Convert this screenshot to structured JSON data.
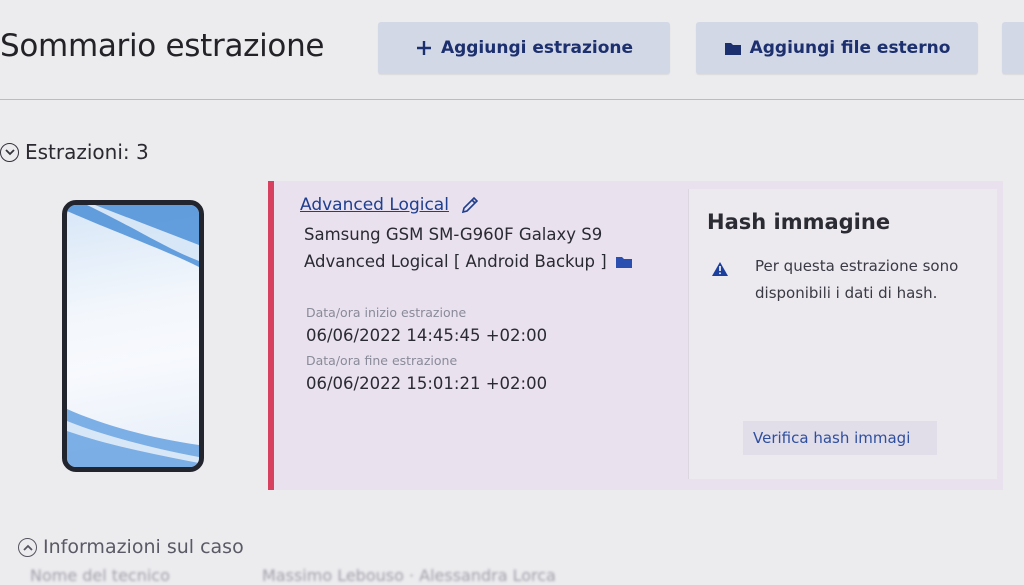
{
  "header": {
    "title": "Sommario estrazione",
    "add_extraction_label": "Aggiungi estrazione",
    "add_external_file_label": "Aggiungi file esterno"
  },
  "extractions_section": {
    "label": "Estrazioni: 3"
  },
  "extraction": {
    "link_label": "Advanced Logical",
    "device": "Samsung GSM SM-G960F Galaxy S9",
    "type": "Advanced Logical [ Android Backup ]",
    "start_label": "Data/ora inizio estrazione",
    "start_value": "06/06/2022 14:45:45 +02:00",
    "end_label": "Data/ora fine estrazione",
    "end_value": "06/06/2022 15:01:21 +02:00"
  },
  "hash_panel": {
    "title": "Hash immagine",
    "message": "Per questa estrazione sono disponibili i dati di hash.",
    "verify_label": "Verifica hash immagi"
  },
  "case_section": {
    "label": "Informazioni sul caso",
    "row_label": "Nome del tecnico",
    "row_value": "Massimo Lebouso · Alessandra Lorca"
  },
  "colors": {
    "accent_red": "#d8405f",
    "link_blue": "#1e3e8f",
    "button_bg": "#d3d8e6",
    "warning_blue": "#1c3f9e"
  },
  "icons": {
    "plus": "plus-icon",
    "folder": "folder-icon",
    "expand": "chevron-down-circle-icon",
    "collapse": "chevron-up-circle-icon",
    "edit": "pencil-icon",
    "warning": "warning-triangle-icon"
  }
}
